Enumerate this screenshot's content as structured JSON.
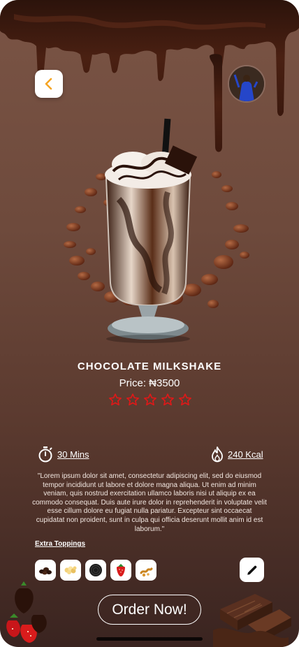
{
  "product": {
    "name": "CHOCOLATE MILKSHAKE",
    "price": "Price: ₦3500",
    "rating_max": 5
  },
  "stats": {
    "time": "30 Mins",
    "calories": "240 Kcal"
  },
  "description": "\"Lorem ipsum dolor sit amet, consectetur adipiscing elit, sed do eiusmod tempor incididunt ut labore et dolore magna aliqua. Ut enim ad minim veniam, quis nostrud exercitation ullamco laboris nisi ut aliquip ex ea commodo consequat. Duis aute irure dolor in reprehenderit in voluptate velit esse cillum dolore eu fugiat nulla pariatur. Excepteur sint occaecat cupidatat non proident, sunt in culpa qui officia deserunt mollit anim id est laborum.\"",
  "toppings": {
    "label": "Extra Toppings",
    "items": [
      "chocolate-chips-icon",
      "popcorn-icon",
      "oreo-cookie-icon",
      "strawberry-icon",
      "caramel-icon"
    ]
  },
  "actions": {
    "order_label": "Order Now!"
  },
  "icons": {
    "back": "chevron-left-icon",
    "timer": "stopwatch-icon",
    "calories": "flame-icon",
    "edit": "pencil-icon"
  },
  "colors": {
    "back_chevron": "#f5a524",
    "star": "#e01818",
    "background_top": "#7a5445",
    "background_bottom": "#3a2420"
  }
}
